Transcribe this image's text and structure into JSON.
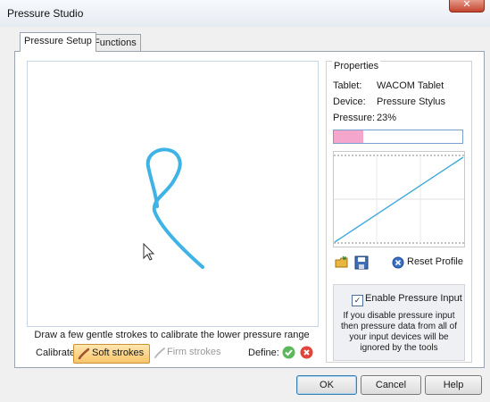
{
  "window": {
    "title": "Pressure Studio",
    "close_glyph": "✕"
  },
  "tabs": [
    {
      "label": "Pressure Setup",
      "active": true
    },
    {
      "label": "Functions",
      "active": false
    }
  ],
  "canvas": {
    "instruction": "Draw a few gentle strokes to calibrate the lower pressure range",
    "stroke_color": "#3fb3e6"
  },
  "calibrate": {
    "label": "Calibrate:",
    "soft_label": "Soft strokes",
    "firm_label": "Firm strokes",
    "define_label": "Define:",
    "accept_icon": "check-icon",
    "reject_icon": "x-icon"
  },
  "properties": {
    "title": "Properties",
    "tablet_label": "Tablet:",
    "tablet_value": "WACOM Tablet",
    "device_label": "Device:",
    "device_value": "Pressure Stylus",
    "pressure_label": "Pressure:",
    "pressure_value": "23%",
    "pressure_fraction": 0.23,
    "pressure_bar_color": "#f4a6cc",
    "curve_color": "#3fa9dd",
    "reset_label": "Reset Profile",
    "enable_label": "Enable Pressure Input",
    "enable_checked": true,
    "help_text": "If you disable pressure input then pressure data from all of your input devices will be ignored by the tools"
  },
  "buttons": {
    "ok": "OK",
    "cancel": "Cancel",
    "help": "Help"
  }
}
